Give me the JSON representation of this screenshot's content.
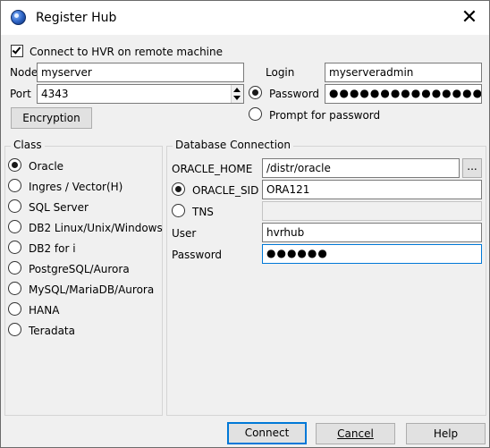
{
  "window": {
    "title": "Register Hub",
    "close_icon": "close-icon"
  },
  "remote": {
    "connect_label": "Connect to HVR on remote machine",
    "connect_checked": true,
    "node_label": "Node",
    "node_value": "myserver",
    "port_label": "Port",
    "port_value": "4343",
    "encryption_label": "Encryption",
    "login_label": "Login",
    "login_value": "myserveradmin",
    "password_label": "Password",
    "password_value": "●●●●●●●●●●●●●●●●",
    "prompt_label": "Prompt for password"
  },
  "class_group": {
    "title": "Class",
    "options": [
      {
        "label": "Oracle",
        "selected": true
      },
      {
        "label": "Ingres / Vector(H)",
        "selected": false
      },
      {
        "label": "SQL Server",
        "selected": false
      },
      {
        "label": "DB2 Linux/Unix/Windows",
        "selected": false
      },
      {
        "label": "DB2 for i",
        "selected": false
      },
      {
        "label": "PostgreSQL/Aurora",
        "selected": false
      },
      {
        "label": "MySQL/MariaDB/Aurora",
        "selected": false
      },
      {
        "label": "HANA",
        "selected": false
      },
      {
        "label": "Teradata",
        "selected": false
      }
    ]
  },
  "db": {
    "title": "Database Connection",
    "oracle_home_label": "ORACLE_HOME",
    "oracle_home_value": "/distr/oracle",
    "browse_label": "...",
    "oracle_sid_label": "ORACLE_SID",
    "oracle_sid_value": "ORA121",
    "tns_label": "TNS",
    "tns_value": "",
    "user_label": "User",
    "user_value": "hvrhub",
    "password_label": "Password",
    "password_value": "●●●●●●"
  },
  "footer": {
    "connect_label": "Connect",
    "cancel_label": "Cancel",
    "help_label": "Help"
  }
}
